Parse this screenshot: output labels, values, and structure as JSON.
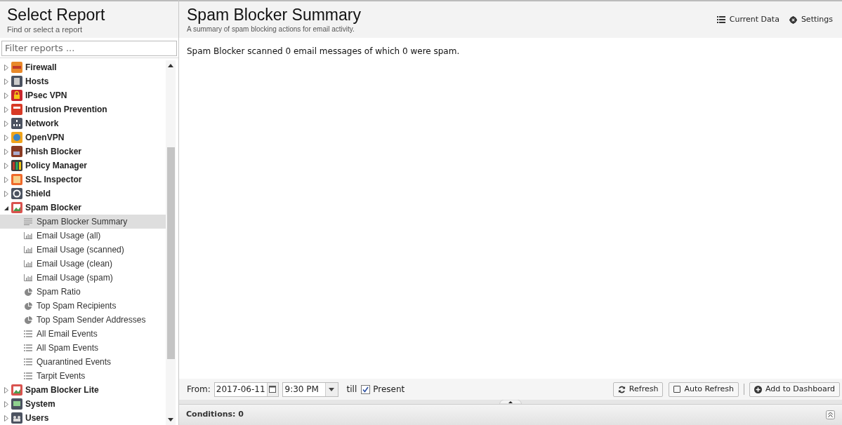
{
  "sidebar": {
    "title": "Select Report",
    "subtitle": "Find or select a report",
    "filter": {
      "placeholder": "Filter reports ..."
    },
    "items": [
      {
        "label": "Firewall",
        "expanded": false
      },
      {
        "label": "Hosts",
        "expanded": false
      },
      {
        "label": "IPsec VPN",
        "expanded": false
      },
      {
        "label": "Intrusion Prevention",
        "expanded": false
      },
      {
        "label": "Network",
        "expanded": false
      },
      {
        "label": "OpenVPN",
        "expanded": false
      },
      {
        "label": "Phish Blocker",
        "expanded": false
      },
      {
        "label": "Policy Manager",
        "expanded": false
      },
      {
        "label": "SSL Inspector",
        "expanded": false
      },
      {
        "label": "Shield",
        "expanded": false
      },
      {
        "label": "Spam Blocker",
        "expanded": true,
        "children": [
          {
            "label": "Spam Blocker Summary",
            "kind": "text",
            "selected": true
          },
          {
            "label": "Email Usage (all)",
            "kind": "bar",
            "selected": false
          },
          {
            "label": "Email Usage (scanned)",
            "kind": "bar",
            "selected": false
          },
          {
            "label": "Email Usage (clean)",
            "kind": "bar",
            "selected": false
          },
          {
            "label": "Email Usage (spam)",
            "kind": "bar",
            "selected": false
          },
          {
            "label": "Spam Ratio",
            "kind": "pie",
            "selected": false
          },
          {
            "label": "Top Spam Recipients",
            "kind": "pie",
            "selected": false
          },
          {
            "label": "Top Spam Sender Addresses",
            "kind": "pie",
            "selected": false
          },
          {
            "label": "All Email Events",
            "kind": "list",
            "selected": false
          },
          {
            "label": "All Spam Events",
            "kind": "list",
            "selected": false
          },
          {
            "label": "Quarantined Events",
            "kind": "list",
            "selected": false
          },
          {
            "label": "Tarpit Events",
            "kind": "list",
            "selected": false
          }
        ]
      },
      {
        "label": "Spam Blocker Lite",
        "expanded": false
      },
      {
        "label": "System",
        "expanded": false
      },
      {
        "label": "Users",
        "expanded": false
      }
    ]
  },
  "report": {
    "title": "Spam Blocker Summary",
    "subtitle": "A summary of spam blocking actions for email activity.",
    "actions": [
      "Current Data",
      "Settings"
    ],
    "text": "Spam Blocker scanned 0 email messages of which 0 were spam."
  },
  "toolbar": {
    "from_label": "From:",
    "date": "2017-06-11",
    "time": "9:30 PM",
    "till_label": "till",
    "present": {
      "label": "Present",
      "checked": true
    },
    "refresh": "Refresh",
    "auto_refresh": {
      "label": "Auto Refresh",
      "checked": false
    },
    "add": "Add to Dashboard"
  },
  "conditions": "Conditions: 0"
}
